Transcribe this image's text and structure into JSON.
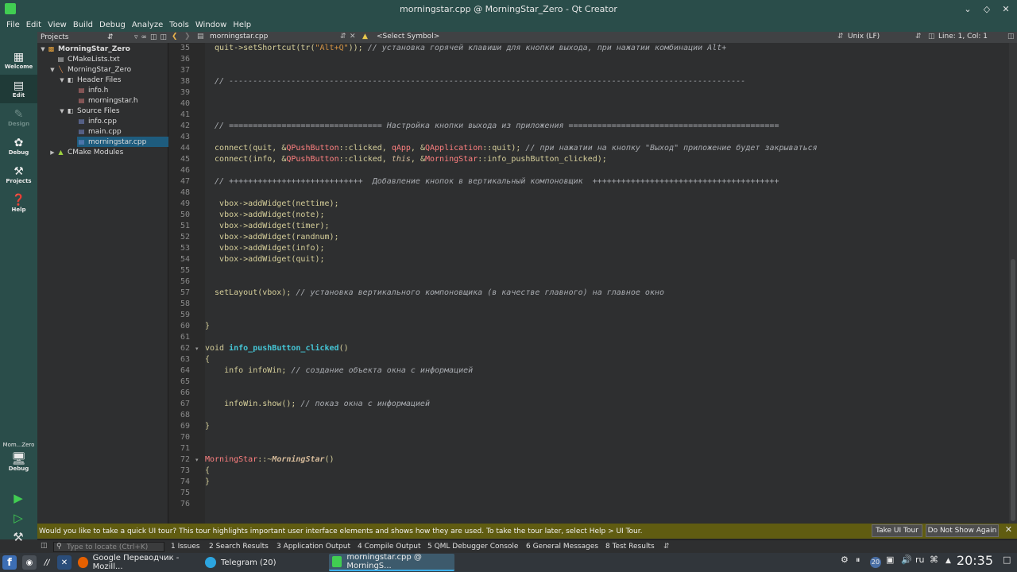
{
  "window": {
    "title": "morningstar.cpp @ MorningStar_Zero - Qt Creator"
  },
  "menu": [
    "File",
    "Edit",
    "View",
    "Build",
    "Debug",
    "Analyze",
    "Tools",
    "Window",
    "Help"
  ],
  "modes": [
    {
      "label": "Welcome",
      "icon": "grid-icon"
    },
    {
      "label": "Edit",
      "icon": "edit-icon"
    },
    {
      "label": "Design",
      "icon": "pen-icon"
    },
    {
      "label": "Debug",
      "icon": "bug-icon"
    },
    {
      "label": "Projects",
      "icon": "wrench-icon"
    },
    {
      "label": "Help",
      "icon": "help-icon"
    }
  ],
  "kit": {
    "project": "Mom...Zero",
    "config": "Debug"
  },
  "projects_pane": {
    "title": "Projects",
    "tree": [
      {
        "label": "MorningStar_Zero",
        "level": 0
      },
      {
        "label": "CMakeLists.txt",
        "level": 1
      },
      {
        "label": "MorningStar_Zero",
        "level": 1
      },
      {
        "label": "Header Files",
        "level": 2
      },
      {
        "label": "info.h",
        "level": 3
      },
      {
        "label": "morningstar.h",
        "level": 3
      },
      {
        "label": "Source Files",
        "level": 2
      },
      {
        "label": "info.cpp",
        "level": 3
      },
      {
        "label": "main.cpp",
        "level": 3
      },
      {
        "label": "morningstar.cpp",
        "level": 3,
        "selected": true
      },
      {
        "label": "CMake Modules",
        "level": 1
      }
    ]
  },
  "editor_bar": {
    "file": "morningstar.cpp",
    "symbol": "<Select Symbol>",
    "line_ending": "Unix (LF)",
    "position": "Line: 1, Col: 1"
  },
  "code_lines": [
    {
      "n": "35",
      "tokens": [
        [
          "n",
          "  quit->setShortcut(tr("
        ],
        [
          "str",
          "\"Alt+Q\""
        ],
        [
          "n",
          "));"
        ],
        [
          "cm",
          " // установка горячей клавиши для кнопки выхода, при нажатии комбинации Alt+"
        ]
      ]
    },
    {
      "n": "36",
      "tokens": []
    },
    {
      "n": "37",
      "tokens": []
    },
    {
      "n": "38",
      "tokens": [
        [
          "cm",
          "  // ------------------------------------------------------------------------------------------------------------"
        ]
      ]
    },
    {
      "n": "39",
      "tokens": []
    },
    {
      "n": "40",
      "tokens": []
    },
    {
      "n": "41",
      "tokens": []
    },
    {
      "n": "42",
      "tokens": [
        [
          "cm",
          "  // ================================ Настройка кнопки выхода из приложения ============================================"
        ]
      ]
    },
    {
      "n": "43",
      "tokens": []
    },
    {
      "n": "44",
      "tokens": [
        [
          "n",
          "  connect(quit, &"
        ],
        [
          "cls",
          "QPushButton"
        ],
        [
          "n",
          "::clicked, "
        ],
        [
          "cls",
          "qApp"
        ],
        [
          "n",
          ", &"
        ],
        [
          "cls",
          "QApplication"
        ],
        [
          "n",
          "::quit);"
        ],
        [
          "cm",
          " // при нажатии на кнопку \"Выход\" приложение будет закрываться"
        ]
      ]
    },
    {
      "n": "45",
      "tokens": [
        [
          "n",
          "  connect(info, &"
        ],
        [
          "cls",
          "QPushButton"
        ],
        [
          "n",
          "::clicked, "
        ],
        [
          "this",
          "this"
        ],
        [
          "n",
          ", &"
        ],
        [
          "cls",
          "MorningStar"
        ],
        [
          "n",
          "::info_pushButton_clicked);"
        ]
      ]
    },
    {
      "n": "46",
      "tokens": []
    },
    {
      "n": "47",
      "tokens": [
        [
          "cm",
          "  // ++++++++++++++++++++++++++++  Добавление кнопок в вертикальный компоновщик  +++++++++++++++++++++++++++++++++++++++"
        ]
      ]
    },
    {
      "n": "48",
      "tokens": []
    },
    {
      "n": "49",
      "tokens": [
        [
          "n",
          "   vbox->addWidget(nettime);"
        ]
      ]
    },
    {
      "n": "50",
      "tokens": [
        [
          "n",
          "   vbox->addWidget(note);"
        ]
      ]
    },
    {
      "n": "51",
      "tokens": [
        [
          "n",
          "   vbox->addWidget(timer);"
        ]
      ]
    },
    {
      "n": "52",
      "tokens": [
        [
          "n",
          "   vbox->addWidget(randnum);"
        ]
      ]
    },
    {
      "n": "53",
      "tokens": [
        [
          "n",
          "   vbox->addWidget(info);"
        ]
      ]
    },
    {
      "n": "54",
      "tokens": [
        [
          "n",
          "   vbox->addWidget(quit);"
        ]
      ]
    },
    {
      "n": "55",
      "tokens": []
    },
    {
      "n": "56",
      "tokens": []
    },
    {
      "n": "57",
      "tokens": [
        [
          "n",
          "  setLayout(vbox);"
        ],
        [
          "cm",
          " // установка вертикального компоновщика (в качестве главного) на главное окно"
        ]
      ]
    },
    {
      "n": "58",
      "tokens": []
    },
    {
      "n": "59",
      "tokens": []
    },
    {
      "n": "60",
      "tokens": [
        [
          "n",
          "}"
        ]
      ]
    },
    {
      "n": "61",
      "tokens": []
    },
    {
      "n": "62",
      "tokens": [
        [
          "n",
          "void "
        ],
        [
          "fn",
          "info_pushButton_clicked"
        ],
        [
          "n",
          "()"
        ]
      ],
      "fold": true
    },
    {
      "n": "63",
      "tokens": [
        [
          "n",
          "{"
        ]
      ]
    },
    {
      "n": "64",
      "tokens": [
        [
          "n",
          "    info infoWin;"
        ],
        [
          "cm",
          " // создание объекта окна с информацией"
        ]
      ]
    },
    {
      "n": "65",
      "tokens": []
    },
    {
      "n": "66",
      "tokens": []
    },
    {
      "n": "67",
      "tokens": [
        [
          "n",
          "    infoWin.show();"
        ],
        [
          "cm",
          " // показ окна с информацией"
        ]
      ]
    },
    {
      "n": "68",
      "tokens": []
    },
    {
      "n": "69",
      "tokens": [
        [
          "n",
          "}"
        ]
      ]
    },
    {
      "n": "70",
      "tokens": []
    },
    {
      "n": "71",
      "tokens": []
    },
    {
      "n": "72",
      "tokens": [
        [
          "cls",
          "MorningStar"
        ],
        [
          "n",
          "::~"
        ],
        [
          "fni",
          "MorningStar"
        ],
        [
          "n",
          "()"
        ]
      ],
      "fold": true
    },
    {
      "n": "73",
      "tokens": [
        [
          "n",
          "{"
        ]
      ]
    },
    {
      "n": "74",
      "tokens": [
        [
          "n",
          "}"
        ]
      ]
    },
    {
      "n": "75",
      "tokens": []
    },
    {
      "n": "76",
      "tokens": []
    }
  ],
  "tour": {
    "message": "Would you like to take a quick UI tour? This tour highlights important user interface elements and shows how they are used. To take the tour later, select Help > UI Tour.",
    "take_label": "Take UI Tour",
    "dismiss_label": "Do Not Show Again"
  },
  "output_panes": {
    "locator_placeholder": "Type to locate (Ctrl+K)",
    "tabs": [
      "1  Issues",
      "2  Search Results",
      "3  Application Output",
      "4  Compile Output",
      "5  QML Debugger Console",
      "6  General Messages",
      "8  Test Results"
    ]
  },
  "taskbar": {
    "tasks": [
      {
        "label": "Google Переводчик - Mozill...",
        "color": "#e66000"
      },
      {
        "label": "Telegram (20)",
        "color": "#2ca5e0"
      },
      {
        "label": "morningstar.cpp @ MorningS...",
        "color": "#41cd52",
        "active": true
      }
    ],
    "tray_badge": "20",
    "lang": "ru",
    "clock": "20:35"
  }
}
